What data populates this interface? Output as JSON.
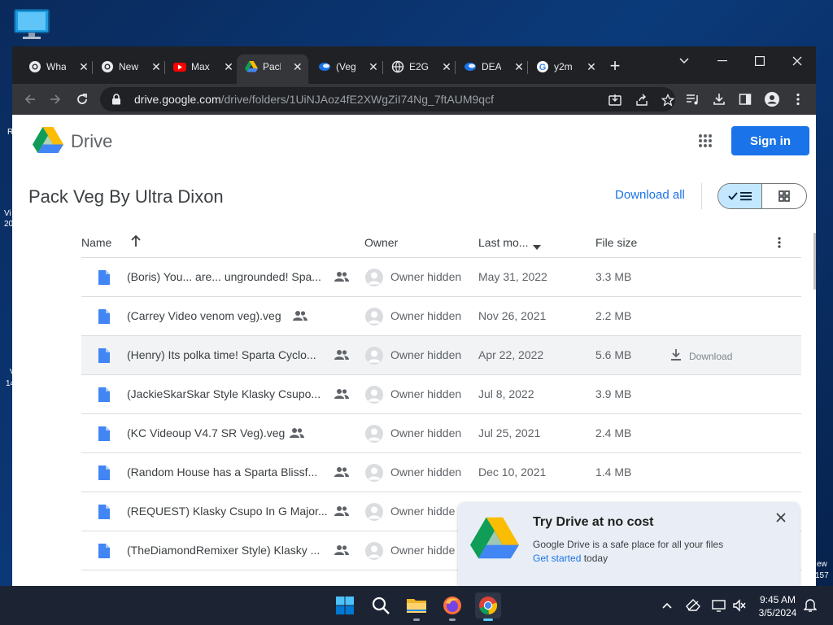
{
  "desktop": {
    "side_texts": [
      {
        "text": "R"
      },
      {
        "text": "Vi"
      },
      {
        "text": "20"
      },
      {
        "text": "V"
      },
      {
        "text": "14"
      },
      {
        "text": "ew"
      },
      {
        "text": "157"
      }
    ]
  },
  "browser": {
    "tabs": [
      {
        "label": "Wha",
        "favicon": "chrome-icon",
        "active": false
      },
      {
        "label": "New",
        "favicon": "chrome-icon",
        "active": false
      },
      {
        "label": "Max",
        "favicon": "youtube-icon",
        "active": false
      },
      {
        "label": "Pack",
        "favicon": "google-drive-icon",
        "active": true
      },
      {
        "label": "(Veg",
        "favicon": "vegas-icon",
        "active": false
      },
      {
        "label": "E2G",
        "favicon": "globe-icon",
        "active": false
      },
      {
        "label": "DEA",
        "favicon": "vegas-icon",
        "active": false
      },
      {
        "label": "y2m",
        "favicon": "google-icon",
        "active": false
      }
    ],
    "url": {
      "host": "drive.google.com",
      "path": "/drive/folders/1UiNJAoz4fE2XWgZiI74Ng_7ftAUM9qcf"
    }
  },
  "drive": {
    "product_name": "Drive",
    "sign_in_label": "Sign in",
    "folder_title": "Pack Veg By Ultra Dixon",
    "download_all_label": "Download all",
    "columns": {
      "name": "Name",
      "owner": "Owner",
      "last_modified": "Last mo...",
      "file_size": "File size"
    },
    "files": [
      {
        "name": "(Boris) You... are... ungrounded! Spa...",
        "owner": "Owner hidden",
        "date": "May 31, 2022",
        "size": "3.3 MB",
        "hover": false
      },
      {
        "name": "(Carrey Video venom veg).veg",
        "owner": "Owner hidden",
        "date": "Nov 26, 2021",
        "size": "2.2 MB",
        "hover": false
      },
      {
        "name": "(Henry) Its polka time! Sparta Cyclo...",
        "owner": "Owner hidden",
        "date": "Apr 22, 2022",
        "size": "5.6 MB",
        "hover": true,
        "download_label": "Download"
      },
      {
        "name": "(JackieSkarSkar Style Klasky Csupo...",
        "owner": "Owner hidden",
        "date": "Jul 8, 2022",
        "size": "3.9 MB",
        "hover": false
      },
      {
        "name": "(KC Videoup V4.7 SR Veg).veg",
        "owner": "Owner hidden",
        "date": "Jul 25, 2021",
        "size": "2.4 MB",
        "hover": false
      },
      {
        "name": "(Random House has a Sparta Blissf...",
        "owner": "Owner hidden",
        "date": "Dec 10, 2021",
        "size": "1.4 MB",
        "hover": false
      },
      {
        "name": "(REQUEST) Klasky Csupo In G Major...",
        "owner": "Owner hidde",
        "date": "",
        "size": "",
        "hover": false
      },
      {
        "name": "(TheDiamondRemixer Style) Klasky ...",
        "owner": "Owner hidde",
        "date": "",
        "size": "",
        "hover": false
      }
    ],
    "promo": {
      "title": "Try Drive at no cost",
      "body": "Google Drive is a safe place for all your files",
      "link_text": "Get started",
      "link_suffix": " today"
    }
  },
  "taskbar": {
    "apps": [
      "windows-start",
      "search",
      "file-explorer",
      "firefox",
      "chrome"
    ],
    "time": "9:45 AM",
    "date": "3/5/2024"
  },
  "colors": {
    "accent": "#1a73e8",
    "doc_icon": "#4285f4"
  }
}
